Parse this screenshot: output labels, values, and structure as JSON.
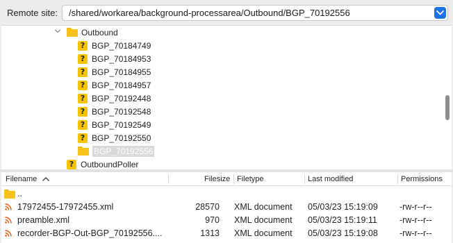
{
  "site": {
    "label": "Remote site:",
    "path": "/shared/workarea/background-processarea/Outbound/BGP_70192556"
  },
  "tree": {
    "parent": "Outbound",
    "children": [
      {
        "label": "BGP_70184749",
        "icon": "unknown-folder"
      },
      {
        "label": "BGP_70184953",
        "icon": "unknown-folder"
      },
      {
        "label": "BGP_70184955",
        "icon": "unknown-folder"
      },
      {
        "label": "BGP_70184957",
        "icon": "unknown-folder"
      },
      {
        "label": "BGP_70192448",
        "icon": "unknown-folder"
      },
      {
        "label": "BGP_70192548",
        "icon": "unknown-folder"
      },
      {
        "label": "BGP_70192549",
        "icon": "unknown-folder"
      },
      {
        "label": "BGP_70192550",
        "icon": "unknown-folder"
      },
      {
        "label": "BGP_70192556",
        "icon": "folder",
        "selected": true
      }
    ],
    "sibling": "OutboundPoller"
  },
  "list": {
    "columns": {
      "filename": "Filename",
      "filesize": "Filesize",
      "filetype": "Filetype",
      "modified": "Last modified",
      "permissions": "Permissions"
    },
    "rows": [
      {
        "name": "..",
        "size": "",
        "type": "",
        "modified": "",
        "perms": "",
        "icon": "folder-icon"
      },
      {
        "name": "17972455-17972455.xml",
        "size": "28570",
        "type": "XML document",
        "modified": "05/03/23 15:19:09",
        "perms": "-rw-r--r--",
        "icon": "rss-icon"
      },
      {
        "name": "preamble.xml",
        "size": "970",
        "type": "XML document",
        "modified": "05/03/23 15:19:11",
        "perms": "-rw-r--r--",
        "icon": "rss-icon"
      },
      {
        "name": "recorder-BGP-Out-BGP_70192556....",
        "size": "1313",
        "type": "XML document",
        "modified": "05/03/23 15:19:08",
        "perms": "-rw-r--r--",
        "icon": "rss-icon"
      }
    ]
  },
  "colors": {
    "accent": "#1a73e8",
    "folder": "#f7c21c",
    "rss": "#e8590c"
  }
}
